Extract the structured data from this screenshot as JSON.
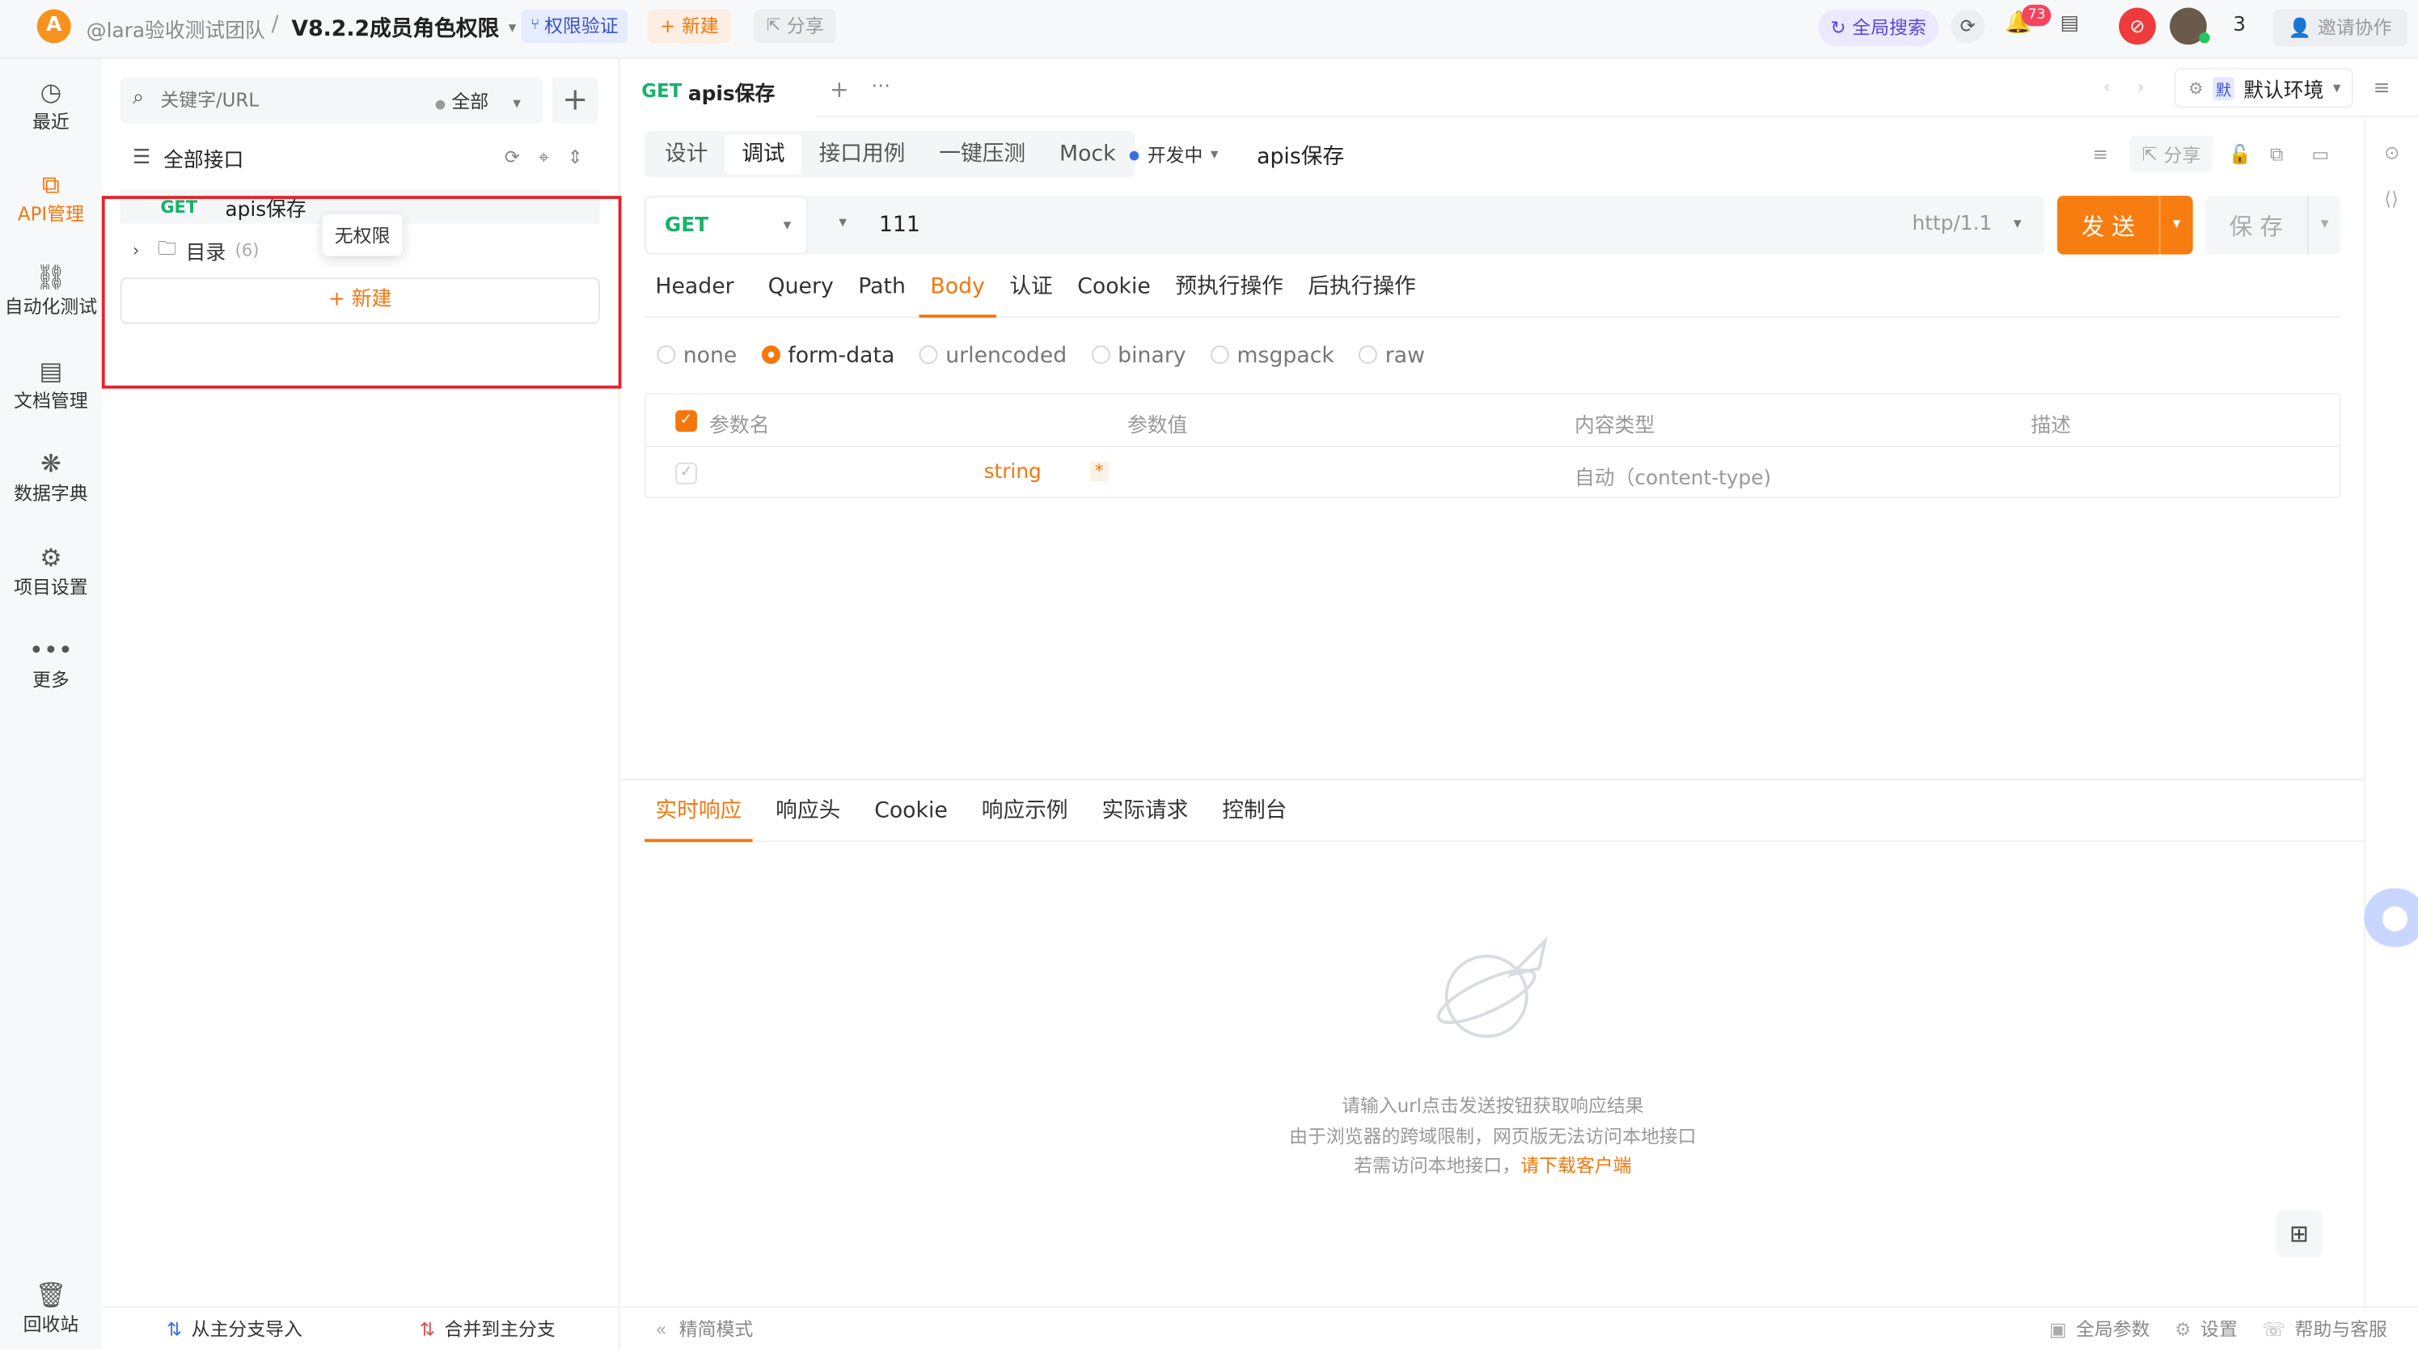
{
  "topbar": {
    "logo_letter": "A",
    "team": "@lara验收测试团队",
    "separator": "/",
    "project": "V8.2.2成员角色权限",
    "permission_badge": "权限验证",
    "new_label": "新建",
    "share_label": "分享",
    "global_search": "全局搜索",
    "notification_count": "73",
    "online_count": "3",
    "invite_label": "邀请协作"
  },
  "rail": {
    "items": [
      {
        "label": "最近",
        "icon": "clock-icon"
      },
      {
        "label": "API管理",
        "icon": "api-icon"
      },
      {
        "label": "自动化测试",
        "icon": "flow-icon"
      },
      {
        "label": "文档管理",
        "icon": "doc-icon"
      },
      {
        "label": "数据字典",
        "icon": "dictionary-icon"
      },
      {
        "label": "项目设置",
        "icon": "settings-icon"
      },
      {
        "label": "更多",
        "icon": "more-icon"
      }
    ],
    "trash": "回收站"
  },
  "tree": {
    "search_placeholder": "关键字/URL",
    "filter": "全部",
    "all_interfaces": "全部接口",
    "api_item": {
      "method": "GET",
      "name": "apis保存"
    },
    "folder": {
      "name": "目录",
      "count": "(6)"
    },
    "tooltip": "无权限",
    "new_label": "新建",
    "import_label": "从主分支导入",
    "merge_label": "合并到主分支"
  },
  "main": {
    "tab": {
      "method": "GET",
      "name": "apis保存"
    },
    "environment_badge": "默",
    "environment": "默认环境",
    "subtabs": [
      "设计",
      "调试",
      "接口用例",
      "一键压测",
      "Mock"
    ],
    "active_subtab": 1,
    "status": "开发中",
    "api_name": "apis保存",
    "share_label": "分享",
    "method": "GET",
    "url": "111",
    "protocol": "http/1.1",
    "send_label": "发 送",
    "save_label": "保 存",
    "req_tabs": [
      "Header",
      "Query",
      "Path",
      "Body",
      "认证",
      "Cookie",
      "预执行操作",
      "后执行操作"
    ],
    "active_req_tab": 3,
    "body_types": [
      "none",
      "form-data",
      "urlencoded",
      "binary",
      "msgpack",
      "raw"
    ],
    "active_body_type": 1,
    "table_headers": [
      "参数名",
      "参数值",
      "内容类型",
      "描述"
    ],
    "row": {
      "type": "string",
      "required": "*",
      "content_type": "自动（content-type)"
    },
    "resp_tabs": [
      "实时响应",
      "响应头",
      "Cookie",
      "响应示例",
      "实际请求",
      "控制台"
    ],
    "active_resp_tab": 0,
    "empty_line1": "请输入url点击发送按钮获取响应结果",
    "empty_line2": "由于浏览器的跨域限制，网页版无法访问本地接口",
    "empty_line3_prefix": "若需访问本地接口，",
    "empty_line3_link": "请下载客户端"
  },
  "bottombar": {
    "simple_mode": "精简模式",
    "global_params": "全局参数",
    "settings": "设置",
    "help": "帮助与客服"
  },
  "colors": {
    "accent": "#f5760b",
    "get": "#17b26a",
    "highlight_border": "#e5222b"
  }
}
